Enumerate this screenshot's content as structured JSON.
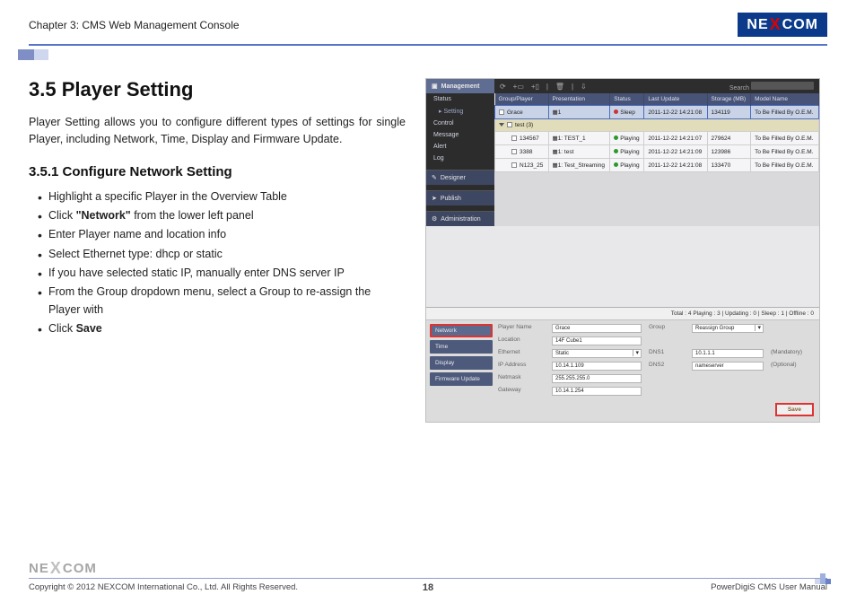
{
  "header": {
    "chapter": "Chapter 3: CMS Web Management Console",
    "brand_pre": "NE",
    "brand_x": "X",
    "brand_post": "COM"
  },
  "section": {
    "title": "3.5 Player Setting",
    "intro": "Player Setting allows you to configure different types of settings for single Player, including Network, Time, Display and Firmware Update.",
    "sub_title": "3.5.1 Configure Network Setting",
    "bullets": [
      {
        "pre": "Highlight a specific Player in the Overview Table"
      },
      {
        "pre": "Click ",
        "bold": "\"Network\"",
        "post": " from the lower left panel"
      },
      {
        "pre": "Enter Player name and location info"
      },
      {
        "pre": "Select Ethernet type: dhcp or static"
      },
      {
        "pre": "If you have selected static IP, manually enter DNS server IP"
      },
      {
        "pre": "From the Group dropdown menu, select a Group to re-assign the Player with"
      },
      {
        "pre": "Click ",
        "bold": "Save"
      }
    ]
  },
  "screenshot": {
    "sidebar": {
      "title": "Management",
      "items": [
        "Status",
        "Setting",
        "Control",
        "Message",
        "Alert",
        "Log"
      ],
      "other": [
        "Designer",
        "Publish",
        "Administration"
      ]
    },
    "toolbar": {
      "search_label": "Search"
    },
    "table": {
      "headers": [
        "Group/Player",
        "Presentation",
        "Status",
        "Last Update",
        "Storage (MB)",
        "Model Name"
      ],
      "rows": [
        {
          "sel": true,
          "grp": false,
          "name": "Grace",
          "pres": "1",
          "status": "Sleep",
          "last": "2011-12-22 14:21:08",
          "stor": "134119",
          "model": "To Be Filled By O.E.M."
        },
        {
          "grp": true,
          "name": "test (3)",
          "pres": "",
          "status": "",
          "last": "",
          "stor": "",
          "model": ""
        },
        {
          "name": "134567",
          "pres": "1: TEST_1",
          "status": "Playing",
          "last": "2011-12-22 14:21:07",
          "stor": "279624",
          "model": "To Be Filled By O.E.M."
        },
        {
          "name": "3388",
          "pres": "1: test",
          "status": "Playing",
          "last": "2011-12-22 14:21:09",
          "stor": "123986",
          "model": "To Be Filled By O.E.M."
        },
        {
          "name": "N123_25",
          "pres": "1: Test_Streaming",
          "status": "Playing",
          "last": "2011-12-22 14:21:08",
          "stor": "133470",
          "model": "To Be Filled By O.E.M."
        }
      ]
    },
    "detail": {
      "summary": "Total : 4   Playing : 3  |  Updating : 0  |  Sleep : 1  |  Offline : 0",
      "tabs": [
        "Network",
        "Time",
        "Display",
        "Firmware Update"
      ],
      "fields": {
        "player_name_lbl": "Player Name",
        "player_name": "Grace",
        "location_lbl": "Location",
        "location": "14F Cube1",
        "group_lbl": "Group",
        "group": "Reassign Group",
        "ethernet_lbl": "Ethernet",
        "ethernet": "Static",
        "ip_lbl": "IP Address",
        "ip": "10.14.1.109",
        "netmask_lbl": "Netmask",
        "netmask": "255.255.255.0",
        "gateway_lbl": "Gateway",
        "gateway": "10.14.1.254",
        "dns1_lbl": "DNS1",
        "dns1": "10.1.1.1",
        "dns1_note": "(Mandatory)",
        "dns2_lbl": "DNS2",
        "dns2": "nameserver",
        "dns2_note": "(Optional)",
        "save": "Save"
      }
    }
  },
  "footer": {
    "brand_pre": "NE",
    "brand_x": "X",
    "brand_post": "COM",
    "copyright": "Copyright © 2012 NEXCOM International Co., Ltd. All Rights Reserved.",
    "page": "18",
    "manual": "PowerDigiS CMS User Manual"
  }
}
